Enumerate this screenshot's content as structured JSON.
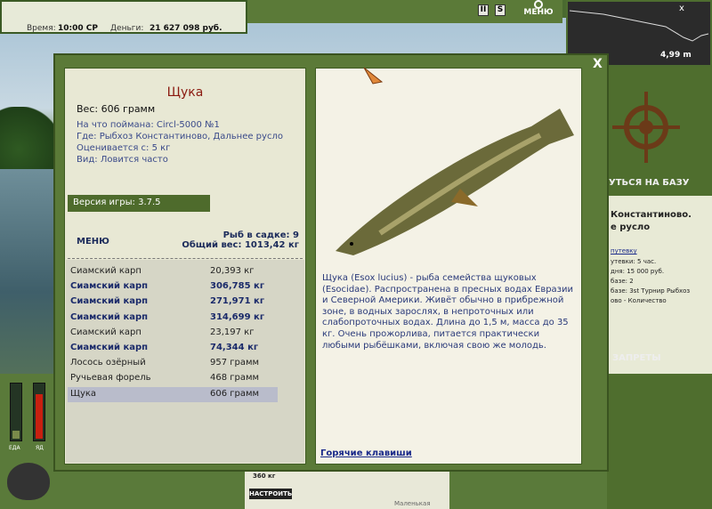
{
  "status": {
    "time_label": "Время:",
    "time_value": "10:00 СР",
    "money_label": "Деньги:",
    "money_value": "21 627 098 руб."
  },
  "toolbar": {
    "pause_label": "II",
    "sound_label": "S",
    "menu_label": "МЕНЮ"
  },
  "depth": {
    "value": "4,99 m",
    "close": "x"
  },
  "right_panel": {
    "return_label": "УТЬСЯ НА БАЗУ",
    "location_line1": "Константиново.",
    "location_line2": "е русло",
    "permit_link": "путевку",
    "lines": [
      "утевки: 5 час.",
      "дня: 15 000 руб.",
      "базе: 2",
      "базе: 3st Турнир Рыбхоз",
      "ово - Количество"
    ],
    "bans_label": "ЗАПРЕТЫ"
  },
  "gauges": {
    "food_label": "ЕДА",
    "poison_label": "ЯД",
    "food_level": 0.15,
    "poison_level": 0.8
  },
  "modal": {
    "close": "X",
    "fish": {
      "name": "Щука",
      "weight": "Вес: 606 грамм",
      "caught_on": "На что поймана: Circl-5000 №1",
      "where": "Где: Рыбхоз Константиново, Дальнее русло",
      "price": "Оценивается с: 5 кг",
      "kind": "Вид: Ловится часто",
      "description": "Щука (Esox lucius) - рыба семейства щуковых (Esocidae). Распространена в пресных водах Евразии и Северной Америки. Живёт обычно в прибрежной зоне, в водных зарослях, в непроточных или слабопроточных водах. Длина до 1,5 м, масса до 35 кг. Очень прожорлива, питается практически любыми рыбёшками, включая свою же молодь."
    },
    "version": "Версия игры: 3.7.5",
    "menu_label": "МЕНЮ",
    "keepnet_count": "Рыб в садке: 9",
    "keepnet_total": "Общий вес: 1013,42 кг",
    "catch_list": [
      {
        "name": "Сиамский карп",
        "weight": "20,393 кг",
        "style": "normal"
      },
      {
        "name": "Сиамский карп",
        "weight": "306,785 кг",
        "style": "bold"
      },
      {
        "name": "Сиамский карп",
        "weight": "271,971 кг",
        "style": "bold"
      },
      {
        "name": "Сиамский карп",
        "weight": "314,699 кг",
        "style": "bold"
      },
      {
        "name": "Сиамский карп",
        "weight": "23,197 кг",
        "style": "normal"
      },
      {
        "name": "Сиамский карп",
        "weight": "74,344 кг",
        "style": "bold"
      },
      {
        "name": "Лосось озёрный",
        "weight": "957 грамм",
        "style": "normal"
      },
      {
        "name": "Ручьевая форель",
        "weight": "468 грамм",
        "style": "normal"
      },
      {
        "name": "Щука",
        "weight": "606 грамм",
        "style": "selected"
      }
    ],
    "hotkeys": "Горячие клавиши"
  },
  "bottom": {
    "price_label": "360 кг",
    "setup_label": "НАСТРОИТЬ",
    "small_label": "Маленькая"
  },
  "colors": {
    "panel_green": "#5b7a38",
    "title_red": "#8b1a10",
    "link_blue": "#1a2a8a"
  }
}
